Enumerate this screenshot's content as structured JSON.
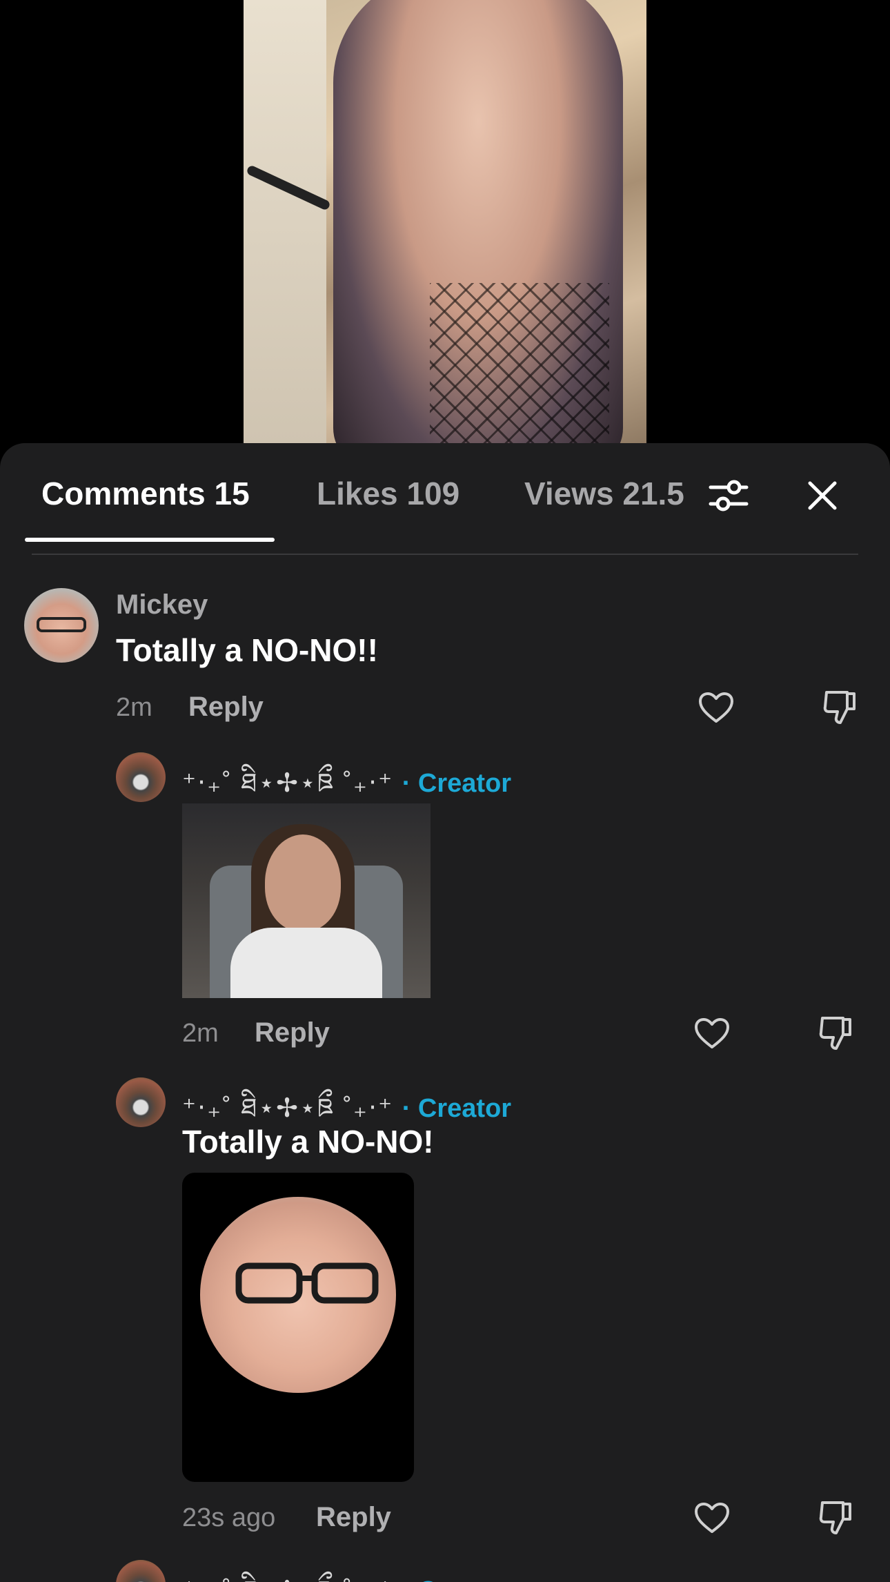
{
  "tabs": {
    "comments_label": "Comments 15",
    "likes_label": "Likes 109",
    "views_label": "Views 21.5"
  },
  "icons": {
    "filter": "sliders-icon",
    "close": "close-icon",
    "like": "heart-icon",
    "dislike": "thumbs-down-icon"
  },
  "colors": {
    "sheet_background": "#1e1e1f",
    "creator_badge": "#1da9d6"
  },
  "comments": [
    {
      "username": "Mickey",
      "text": "Totally a NO-NO!!",
      "time": "2m",
      "reply_label": "Reply"
    }
  ],
  "replies": [
    {
      "username": "⁺‧₊˚ ཐི⋆✢⋆ཋྀ ˚₊‧⁺",
      "badge": "· Creator",
      "time": "2m",
      "reply_label": "Reply"
    },
    {
      "username": "⁺‧₊˚ ཐི⋆✢⋆ཋྀ ˚₊‧⁺",
      "badge": "· Creator",
      "text": "Totally a NO-NO!",
      "time": "23s ago",
      "reply_label": "Reply"
    },
    {
      "username": "⁺‧₊˚ ཐི⋆✢⋆ཋྀ ˚₊‧⁺",
      "badge": "· Creator"
    }
  ]
}
